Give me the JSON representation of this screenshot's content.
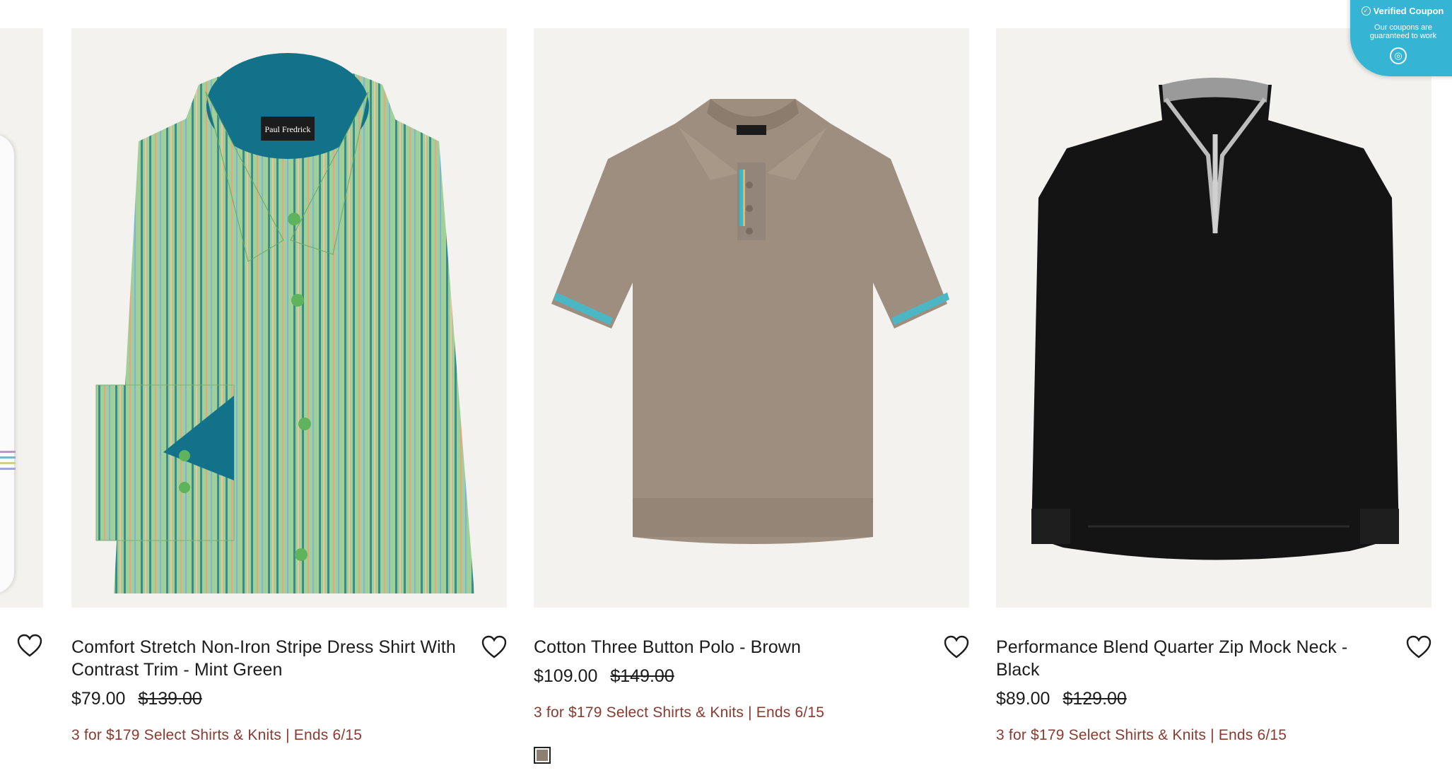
{
  "products": [
    {
      "title": "Comfort Stretch Non-Iron Stripe Dress Shirt With Contrast Trim - Mint Green",
      "sale_price": "$79.00",
      "original_price": "$139.00",
      "promo": "3 for $179 Select Shirts & Knits | Ends 6/15",
      "brand_label": "Paul Fredrick"
    },
    {
      "title": "Cotton Three Button Polo - Brown",
      "sale_price": "$109.00",
      "original_price": "$149.00",
      "promo": "3 for $179 Select Shirts & Knits | Ends 6/15",
      "swatch_color": "#8d7f72"
    },
    {
      "title": "Performance Blend Quarter Zip Mock Neck - Black",
      "sale_price": "$89.00",
      "original_price": "$129.00",
      "promo": "3 for $179 Select Shirts & Knits | Ends 6/15"
    }
  ],
  "coupon_badge": {
    "title": "Verified Coupon",
    "subtitle_line1": "Our coupons are",
    "subtitle_line2": "guaranteed to work",
    "icon": "coupon-icon"
  },
  "colors": {
    "promo_text": "#8a3a30",
    "image_bg": "#f3f2ee",
    "badge_bg": "#35b4d4"
  }
}
